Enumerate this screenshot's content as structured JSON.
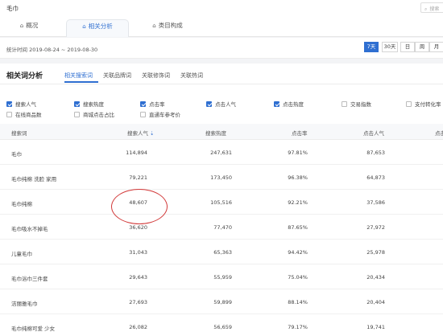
{
  "app": {
    "title": "毛巾",
    "search_placeholder": "搜索"
  },
  "tabs": [
    {
      "label": "概况",
      "icon": "home-icon"
    },
    {
      "label": "相关分析",
      "icon": "home-icon",
      "active": true
    },
    {
      "label": "类目构成",
      "icon": "home-icon"
    }
  ],
  "date_bar": {
    "label": "统计时间 2019-08-24 ~ 2019-08-30",
    "periods": [
      "7天",
      "30天",
      "日",
      "周",
      "月"
    ],
    "active_period": "7天"
  },
  "section": {
    "title": "相关词分析",
    "subtabs": [
      "相关搜索词",
      "关联品牌词",
      "关联修饰词",
      "关联热词"
    ],
    "active_subtab": "相关搜索词"
  },
  "metrics": [
    {
      "label": "搜索人气",
      "checked": true
    },
    {
      "label": "搜索热度",
      "checked": true
    },
    {
      "label": "点击率",
      "checked": true
    },
    {
      "label": "点击人气",
      "checked": true
    },
    {
      "label": "点击热度",
      "checked": true
    },
    {
      "label": "交易指数",
      "checked": false
    },
    {
      "label": "支付转化率",
      "checked": false
    },
    {
      "label": "在线商品数",
      "checked": false
    },
    {
      "label": "商城点击占比",
      "checked": false
    },
    {
      "label": "直通车参考价",
      "checked": false
    }
  ],
  "table": {
    "columns": [
      "搜索词",
      "搜索人气",
      "搜索热度",
      "点击率",
      "点击人气",
      "点击热度"
    ],
    "sort_column": "搜索人气",
    "sort_glyph": "⇣",
    "rows": [
      [
        "毛巾",
        "114,894",
        "247,631",
        "97.81%",
        "87,653",
        ""
      ],
      [
        "毛巾纯棉 洗脸 家用",
        "79,221",
        "173,450",
        "96.38%",
        "64,873",
        ""
      ],
      [
        "毛巾纯棉",
        "48,607",
        "105,516",
        "92.21%",
        "37,586",
        ""
      ],
      [
        "毛巾吸水不掉毛",
        "36,620",
        "77,470",
        "87.65%",
        "27,972",
        ""
      ],
      [
        "儿童毛巾",
        "31,043",
        "65,363",
        "94.42%",
        "25,978",
        ""
      ],
      [
        "毛巾浴巾三件套",
        "29,643",
        "55,959",
        "75.04%",
        "20,434",
        ""
      ],
      [
        "洁丽雅毛巾",
        "27,693",
        "59,899",
        "88.14%",
        "20,404",
        ""
      ],
      [
        "毛巾纯棉可爱 少女",
        "26,082",
        "56,659",
        "79.17%",
        "19,741",
        ""
      ]
    ]
  },
  "colors": {
    "accent": "#2f6fd1",
    "annotation": "#d23a3a"
  }
}
